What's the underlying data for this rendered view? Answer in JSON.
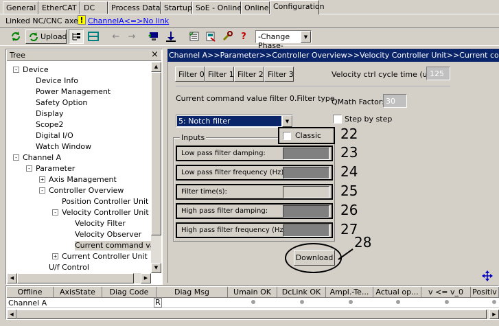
{
  "tabs": [
    {
      "label": "General"
    },
    {
      "label": "EtherCAT"
    },
    {
      "label": "DC"
    },
    {
      "label": "Process Data"
    },
    {
      "label": "Startup"
    },
    {
      "label": "SoE - Online"
    },
    {
      "label": "Online"
    },
    {
      "label": "Configuration",
      "active": true
    }
  ],
  "linked": {
    "label": "Linked NC/CNC axes:",
    "badge": "!",
    "link": "ChannelA<=>No link"
  },
  "toolbar": {
    "upload": "Upload",
    "phase_select": "-Change Phase-"
  },
  "tree": {
    "title": "Tree",
    "close": "×",
    "items": [
      {
        "label": "Device",
        "expander": "-"
      },
      {
        "label": "Device Info"
      },
      {
        "label": "Power Management"
      },
      {
        "label": "Safety Option"
      },
      {
        "label": "Display"
      },
      {
        "label": "Scope2"
      },
      {
        "label": "Digital I/O"
      },
      {
        "label": "Watch Window"
      },
      {
        "label": "Channel A",
        "expander": "-"
      },
      {
        "label": "Parameter",
        "expander": "-"
      },
      {
        "label": "Axis Management",
        "expander": "+"
      },
      {
        "label": "Controller Overview",
        "expander": "-"
      },
      {
        "label": "Position Controller Unit"
      },
      {
        "label": "Velocity Controller Unit",
        "expander": "-"
      },
      {
        "label": "Velocity Filter"
      },
      {
        "label": "Velocity Observer"
      },
      {
        "label": "Current command value",
        "selected": true
      },
      {
        "label": "Current Controller Unit",
        "expander": "+"
      },
      {
        "label": "U/f Control"
      }
    ]
  },
  "breadcrumb": "Channel A>>Parameter>>Controller Overview>>Velocity Controller Unit>>Current command value filter",
  "filter_tabs": [
    "Filter 0",
    "Filter 1",
    "Filter 2",
    "Filter 3"
  ],
  "cycle_time": {
    "label": "Velocity ctrl cycle time (us):",
    "value": "125"
  },
  "filter_type": {
    "label": "Current command value filter 0.Filter type",
    "selected": "5: Notch filter"
  },
  "qmath": {
    "label": "QMath Factor:",
    "value": "30"
  },
  "step_by_step": "Step by step",
  "classic": "Classic",
  "inputs_group": "Inputs",
  "inputs": [
    {
      "label": "Low pass filter damping:",
      "num": "23"
    },
    {
      "label": "Low pass filter frequency (Hz):",
      "num": "24"
    },
    {
      "label": "Filter time(s):",
      "num": "25"
    },
    {
      "label": "High pass filter damping:",
      "num": "26"
    },
    {
      "label": "High pass filter frequency (Hz):",
      "num": "27"
    }
  ],
  "callouts": {
    "classic": "22",
    "download": "28"
  },
  "download": "Download",
  "grid": {
    "headers": [
      "Offline",
      "AxisState",
      "Diag Code",
      "Diag Msg",
      "Umain OK",
      "DcLink OK",
      "Ampl.-Te...",
      "Actual op...",
      "v <= v_0",
      "Positiv"
    ],
    "row": {
      "name": "Channel A",
      "diag_code": "R"
    }
  },
  "colors": {
    "accent": "#0a246a",
    "link": "#0000ff",
    "badge": "#ffff00"
  }
}
